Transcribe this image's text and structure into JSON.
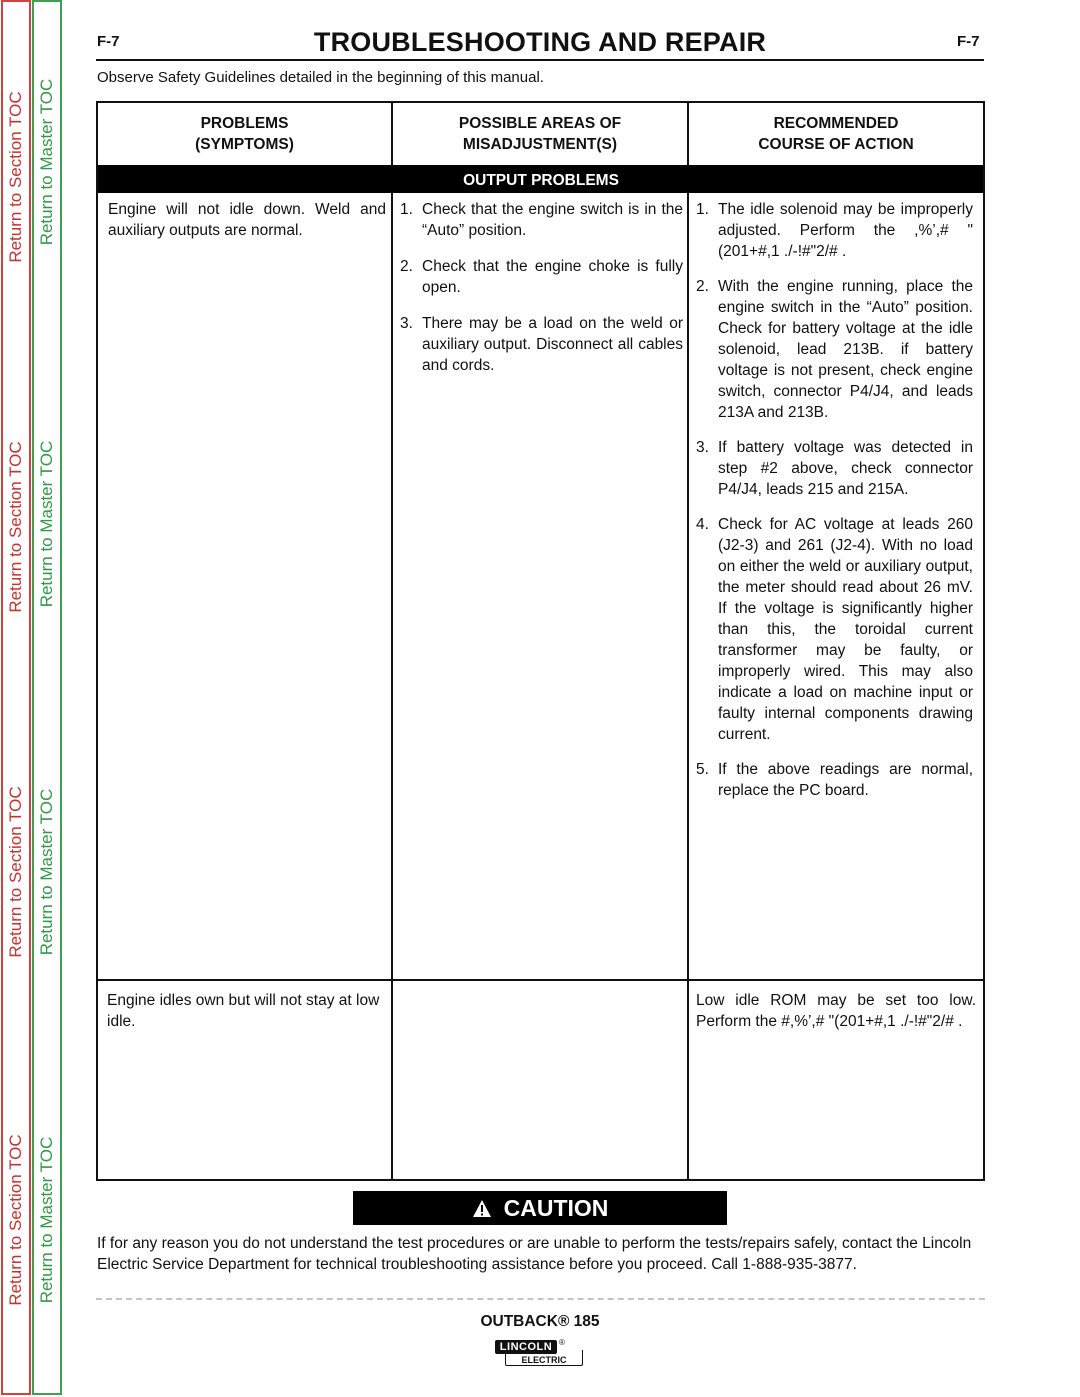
{
  "sidebar": {
    "section_toc_label": "Return to Section TOC",
    "master_toc_label": "Return to Master TOC",
    "section_color": "#cc2f2f",
    "master_color": "#2f9a47"
  },
  "header": {
    "page_code_left": "F-7",
    "page_code_right": "F-7",
    "title": "TROUBLESHOOTING AND REPAIR",
    "safety_note": "Observe Safety Guidelines detailed in the beginning of this manual."
  },
  "table": {
    "headers": [
      {
        "line1": "PROBLEMS",
        "line2": "(SYMPTOMS)"
      },
      {
        "line1": "POSSIBLE AREAS OF",
        "line2": "MISADJUSTMENT(S)"
      },
      {
        "line1": "RECOMMENDED",
        "line2": "COURSE OF ACTION"
      }
    ],
    "section": "OUTPUT PROBLEMS",
    "rows": [
      {
        "problem": "Engine will not idle down.  Weld and auxiliary outputs are normal.",
        "areas": [
          {
            "num": "1.",
            "text": "Check that the engine switch is in the “Auto” position."
          },
          {
            "num": "2.",
            "text": "Check that the engine choke is fully open."
          },
          {
            "num": "3.",
            "text": "There may be a load on the weld or auxiliary output. Disconnect all cables and cords."
          }
        ],
        "actions": [
          {
            "num": "1.",
            "text": "The idle solenoid may be improperly adjusted.  Perform the  ,%’,#      \"(201+#,1  ./-!#\"2/#     ."
          },
          {
            "num": "2.",
            "text": "With the engine running, place the engine switch in the “Auto” position.  Check for battery voltage at the idle solenoid, lead 213B.  if battery voltage is not present, check engine switch, connector P4/J4, and leads 213A and 213B."
          },
          {
            "num": "3.",
            "text": "If battery voltage was detected in step #2 above, check connector P4/J4, leads 215 and 215A."
          },
          {
            "num": "4.",
            "text": "Check for AC voltage at leads 260 (J2-3) and 261 (J2-4). With no load on either the weld or auxiliary output, the meter should read about 26 mV.  If the voltage is significantly higher than this, the toroidal current transformer may be faulty, or improperly wired. This may also indicate a load on machine input or faulty internal components drawing current."
          },
          {
            "num": "5.",
            "text": "If the above readings are normal, replace the PC board."
          }
        ]
      },
      {
        "problem": "Engine idles own but will not stay at low idle.",
        "areas": [],
        "action_text": "Low idle ROM may be set too low. Perform   the   #,%’,#   \"(201+#,1 ./-!#\"2/#      ."
      }
    ]
  },
  "caution": {
    "label": "CAUTION",
    "text": "If for any reason you do not understand the test procedures or are unable to perform the tests/repairs safely, contact the Lincoln Electric Service Department for technical troubleshooting assistance before you proceed. Call 1-888-935-3877."
  },
  "footer": {
    "model": "OUTBACK® 185",
    "logo_top": "LINCOLN",
    "logo_bottom": "ELECTRIC",
    "logo_reg": "®"
  }
}
